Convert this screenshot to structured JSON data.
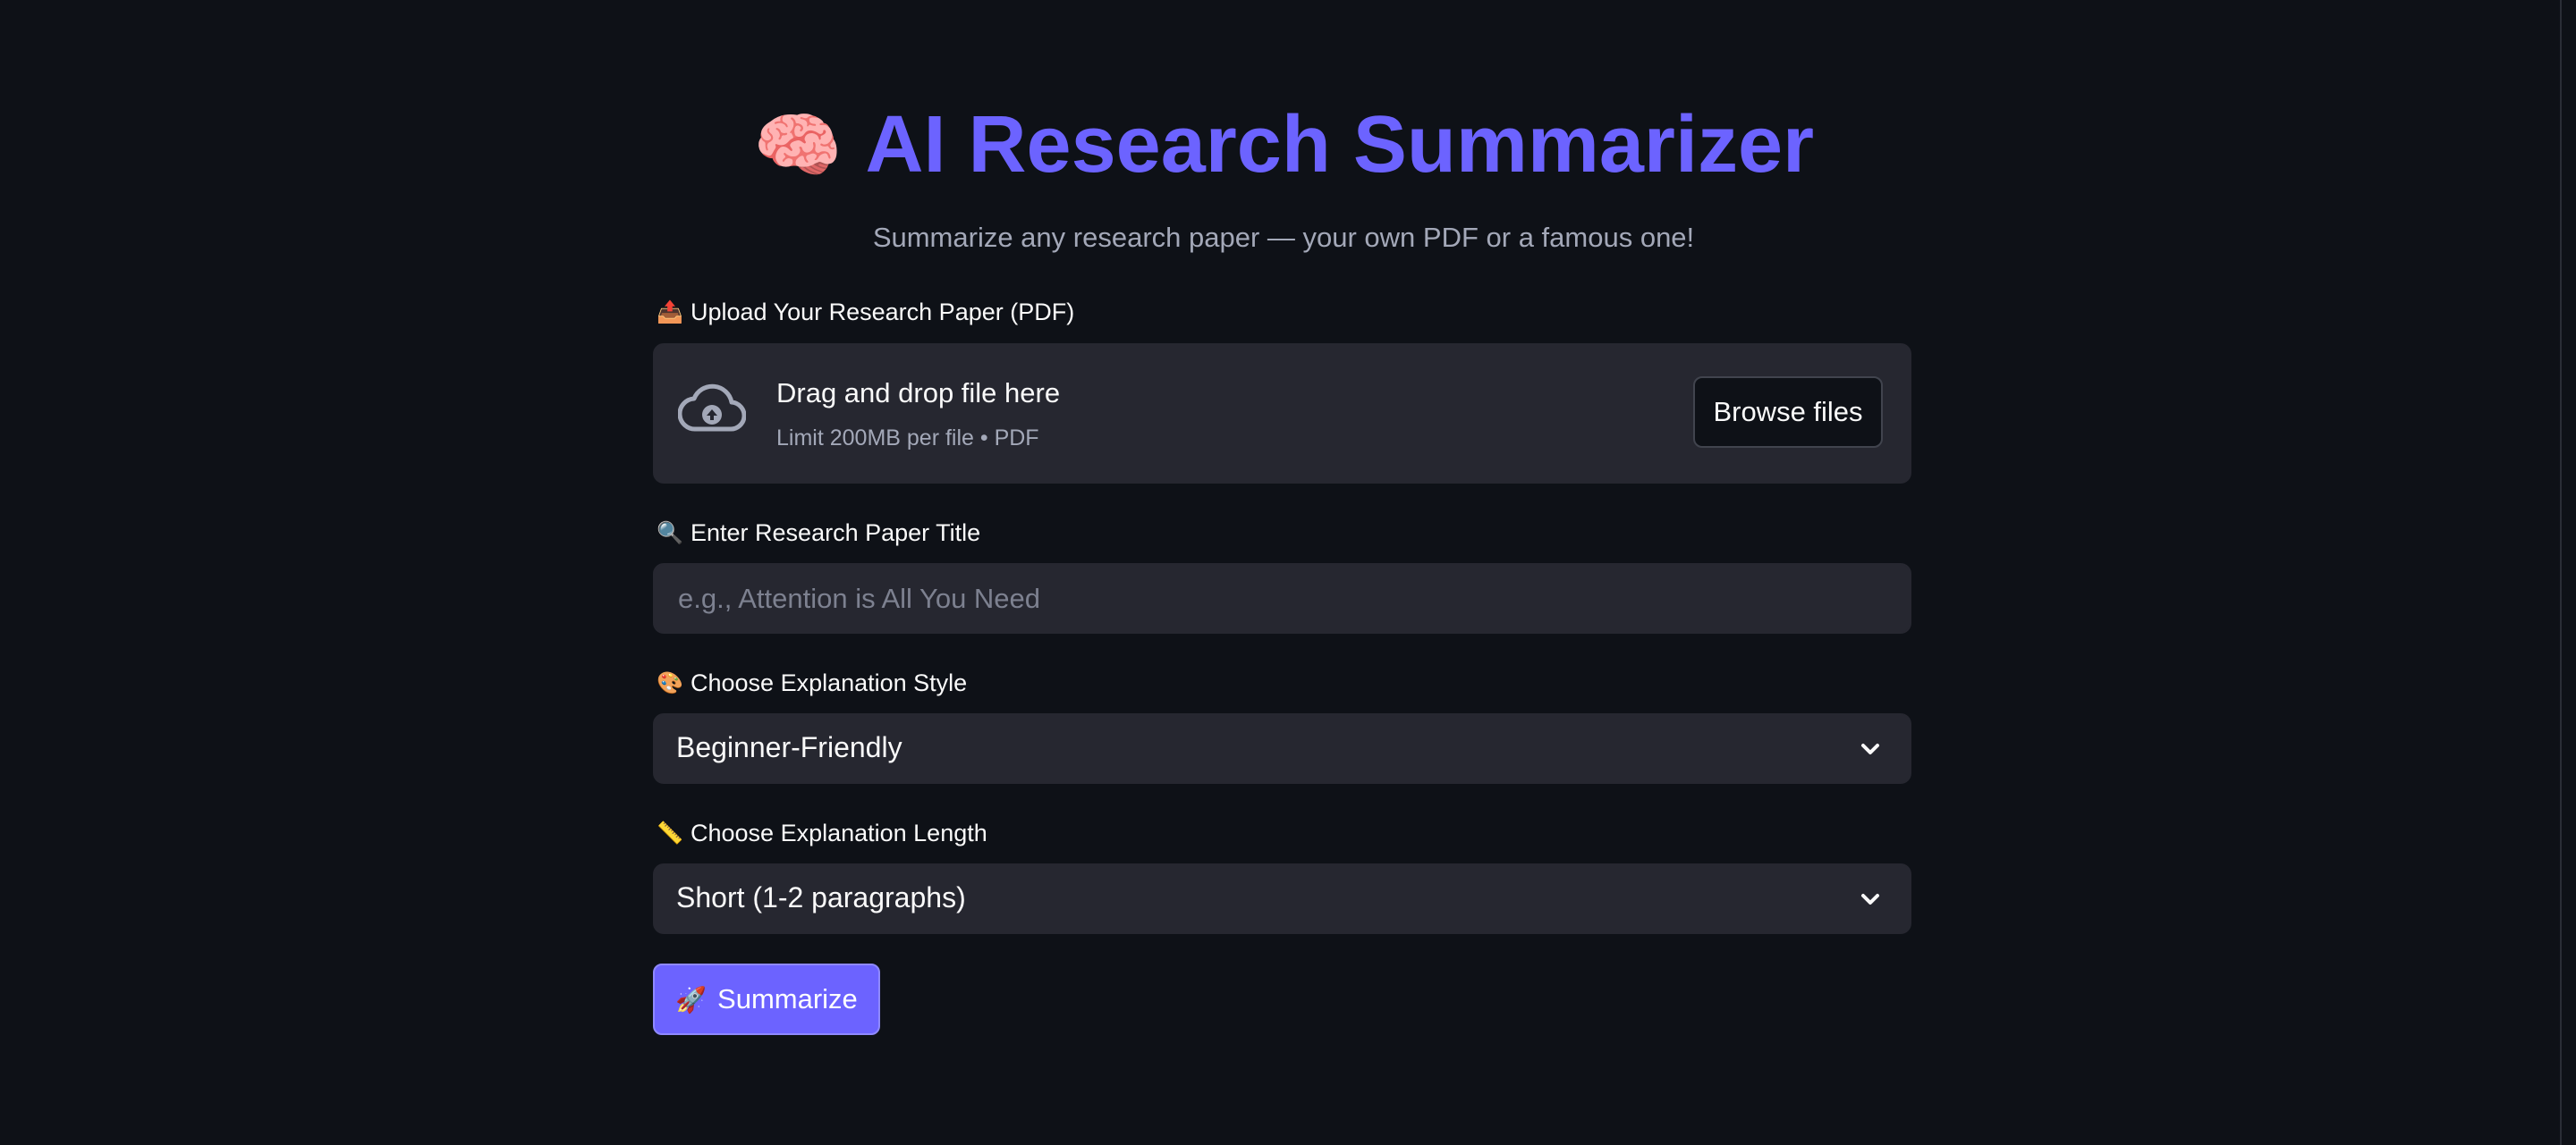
{
  "header": {
    "title_emoji": "🧠",
    "title": "AI Research Summarizer",
    "subtitle": "Summarize any research paper — your own PDF or a famous one!"
  },
  "upload": {
    "label_icon": "📤",
    "label": "Upload Your Research Paper (PDF)",
    "drop_title": "Drag and drop file here",
    "drop_hint": "Limit 200MB per file • PDF",
    "browse_label": "Browse files"
  },
  "title_input": {
    "label_icon": "🔍",
    "label": "Enter Research Paper Title",
    "value": "",
    "placeholder": "e.g., Attention is All You Need"
  },
  "style_select": {
    "label_icon": "🎨",
    "label": "Choose Explanation Style",
    "value": "Beginner-Friendly"
  },
  "length_select": {
    "label_icon": "📏",
    "label": "Choose Explanation Length",
    "value": "Short (1-2 paragraphs)"
  },
  "submit": {
    "icon": "🚀",
    "label": "Summarize"
  },
  "colors": {
    "background": "#0e1117",
    "accent": "#6c63ff",
    "surface": "#262730"
  }
}
